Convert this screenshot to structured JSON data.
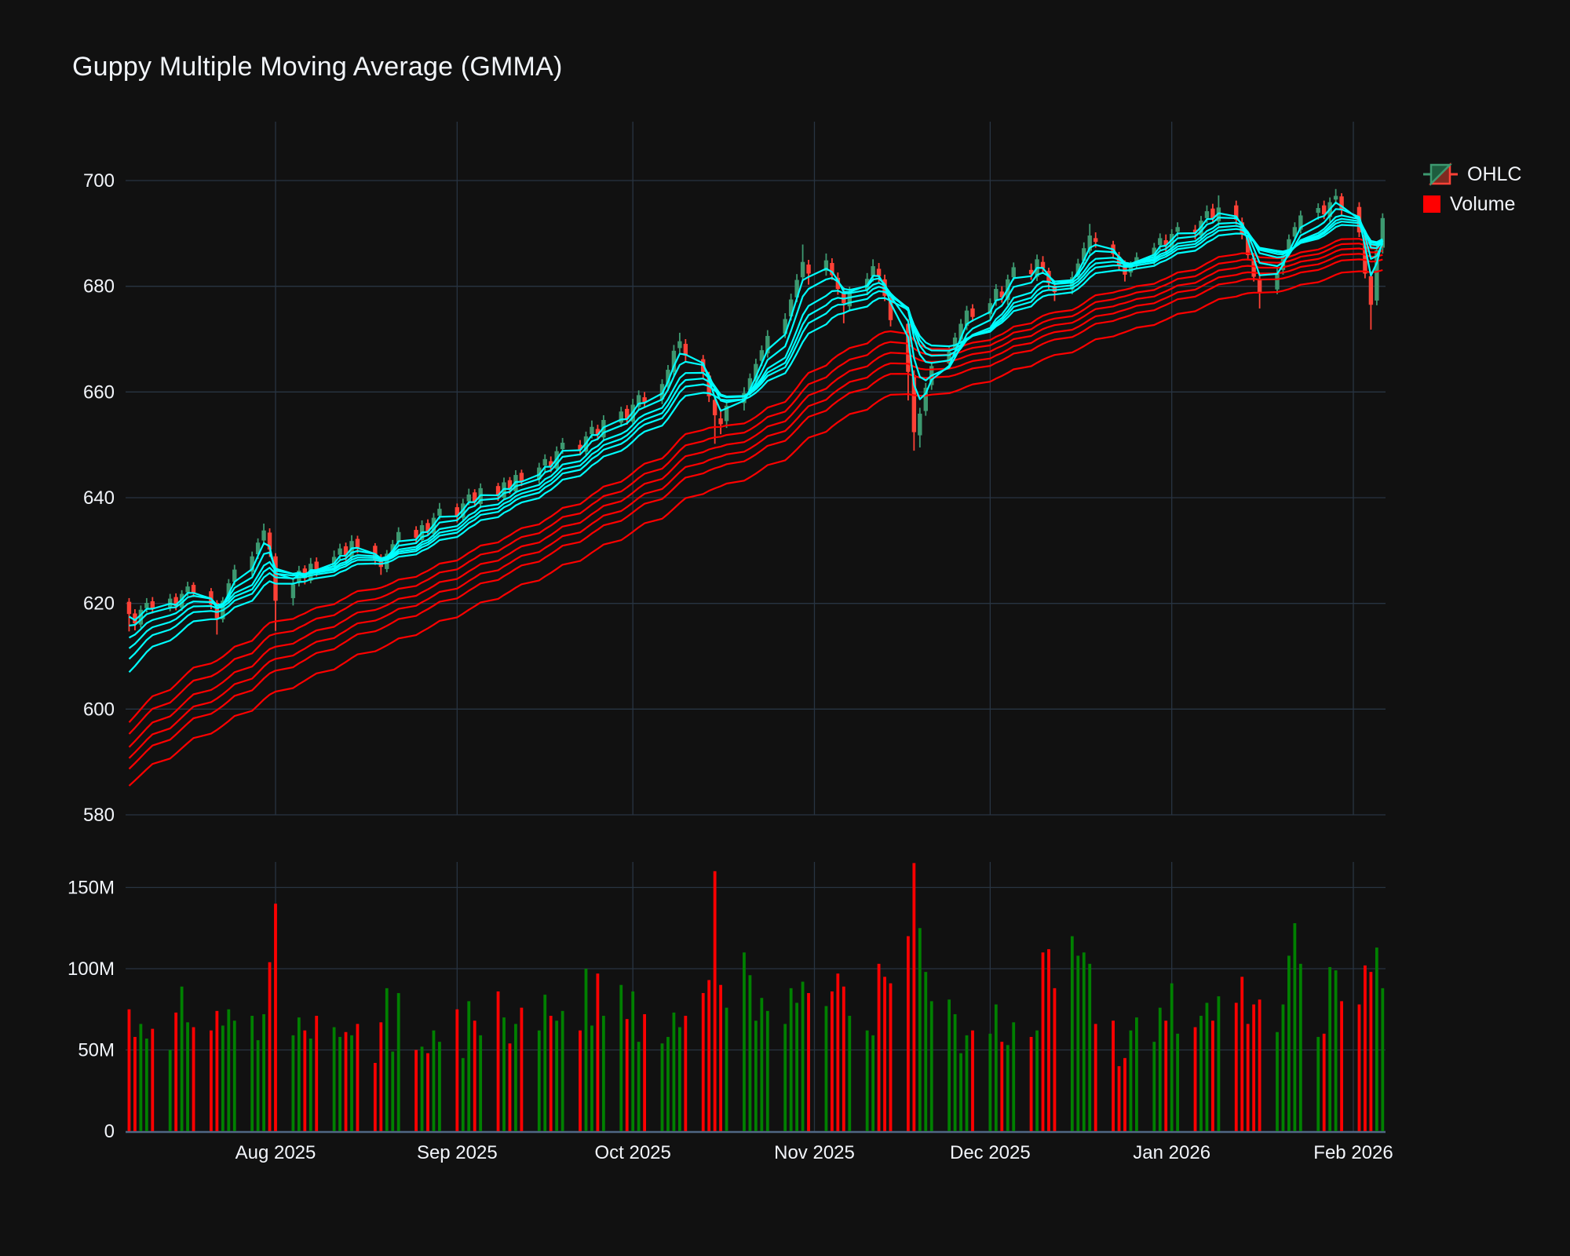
{
  "title": "Guppy Multiple Moving Average (GMMA)",
  "legend": {
    "ohlc_label": "OHLC",
    "volume_label": "Volume"
  },
  "colors": {
    "background": "#111111",
    "grid": "#283442",
    "axis_line": "#506784",
    "text": "#f2f5fa",
    "candle_up": "#3D9970",
    "candle_down": "#FF4136",
    "volume_up": "#008000",
    "volume_down": "#FF0000",
    "gmma_short": "#00FFFF",
    "gmma_long": "#FF0000"
  },
  "chart_data": {
    "type": "candlestick",
    "title": "Guppy Multiple Moving Average (GMMA)",
    "start_date": "2025-07-07",
    "frequency": "business_days",
    "open": [
      620.3,
      618.1,
      616.0,
      619.1,
      620.4,
      619.3,
      621.2,
      619.2,
      622.1,
      623.5,
      622.3,
      620.1,
      617.0,
      620.9,
      624.1,
      626.0,
      629.3,
      631.9,
      633.4,
      628.9,
      621.0,
      624.0,
      626.6,
      624.3,
      627.9,
      627.0,
      629.2,
      630.8,
      628.7,
      632.2,
      630.9,
      628.6,
      626.5,
      629.8,
      631.6,
      633.9,
      632.0,
      635.2,
      633.2,
      636.6,
      638.2,
      636.2,
      639.3,
      641.0,
      638.8,
      642.2,
      640.0,
      643.3,
      641.2,
      644.7,
      643.5,
      646.1,
      646.9,
      645.5,
      649.2,
      650.0,
      648.7,
      652.0,
      653.0,
      651.4,
      654.2,
      656.8,
      654.4,
      657.2,
      659.0,
      658.6,
      661.0,
      663.8,
      668.3,
      669.1,
      666.2,
      663.1,
      658.5,
      655.0,
      654.5,
      657.9,
      660.3,
      662.0,
      665.9,
      667.3,
      671.0,
      674.3,
      677.9,
      681.7,
      684.1,
      682.9,
      684.4,
      681.6,
      678.9,
      676.2,
      679.4,
      681.9,
      683.3,
      681.3,
      677.6,
      672.9,
      663.2,
      651.8,
      656.4,
      661.3,
      665.4,
      668.1,
      669.9,
      672.5,
      675.8,
      674.7,
      677.2,
      679.0,
      677.4,
      681.7,
      683.1,
      681.8,
      684.6,
      682.9,
      680.1,
      679.4,
      682.1,
      684.8,
      686.7,
      689.1,
      687.9,
      685.6,
      684.3,
      682.6,
      684.2,
      685.0,
      687.8,
      688.7,
      687.3,
      690.3,
      690.7,
      689.6,
      692.9,
      694.7,
      692.3,
      695.3,
      692.1,
      689.3,
      685.4,
      681.3,
      679.4,
      683.1,
      686.3,
      689.4,
      690.7,
      693.9,
      695.3,
      693.1,
      696.4,
      697.0,
      695.0,
      689.7,
      681.9,
      677.3,
      687.3
    ],
    "high": [
      621.0,
      618.9,
      619.6,
      621.0,
      621.2,
      621.8,
      621.9,
      622.5,
      624.1,
      624.0,
      622.9,
      620.6,
      621.2,
      624.6,
      627.3,
      629.8,
      632.3,
      635.1,
      634.2,
      629.5,
      624.8,
      627.1,
      627.2,
      628.6,
      628.7,
      630.0,
      631.3,
      631.5,
      632.9,
      632.8,
      631.4,
      629.3,
      630.1,
      632.0,
      634.4,
      634.6,
      635.7,
      635.9,
      637.1,
      639.0,
      638.9,
      639.8,
      641.7,
      641.6,
      642.7,
      642.8,
      643.8,
      643.9,
      645.2,
      645.3,
      646.6,
      648.2,
      647.8,
      649.7,
      651.3,
      650.9,
      652.5,
      654.6,
      653.8,
      655.6,
      657.2,
      657.5,
      658.7,
      660.3,
      660.0,
      662.4,
      665.1,
      668.9,
      671.2,
      670.0,
      667.0,
      663.8,
      659.4,
      656.8,
      658.3,
      660.9,
      663.5,
      666.3,
      668.8,
      671.7,
      674.9,
      678.6,
      682.3,
      687.9,
      685.0,
      686.2,
      685.3,
      682.6,
      679.8,
      679.9,
      682.5,
      685.1,
      684.4,
      682.2,
      678.5,
      673.8,
      664.1,
      657.0,
      661.7,
      665.8,
      668.5,
      671.2,
      673.8,
      676.3,
      676.6,
      677.7,
      680.4,
      680.0,
      682.2,
      684.5,
      684.3,
      686.0,
      685.7,
      683.5,
      681.0,
      682.8,
      685.2,
      688.3,
      691.8,
      690.2,
      688.6,
      686.5,
      684.9,
      684.7,
      686.4,
      688.2,
      690.0,
      689.8,
      690.8,
      692.1,
      691.6,
      693.3,
      695.3,
      695.6,
      697.2,
      696.2,
      693.0,
      690.1,
      686.3,
      682.2,
      683.5,
      686.7,
      689.8,
      692.1,
      694.3,
      695.7,
      696.2,
      696.8,
      698.4,
      697.6,
      695.9,
      690.5,
      682.8,
      688.0,
      693.8
    ],
    "low": [
      614.7,
      614.9,
      615.4,
      618.3,
      618.1,
      618.5,
      618.7,
      618.6,
      621.4,
      621.2,
      618.9,
      614.1,
      616.4,
      620.2,
      623.4,
      625.2,
      628.4,
      631.0,
      628.8,
      614.8,
      619.6,
      623.2,
      623.6,
      623.8,
      625.1,
      626.1,
      628.3,
      628.0,
      628.1,
      629.5,
      627.3,
      625.4,
      625.9,
      629.0,
      630.8,
      631.5,
      631.4,
      632.8,
      632.6,
      635.9,
      635.3,
      635.5,
      638.6,
      638.3,
      638.0,
      639.4,
      639.6,
      640.7,
      640.8,
      642.2,
      642.7,
      644.9,
      644.8,
      645.0,
      648.3,
      648.0,
      648.1,
      651.2,
      650.9,
      650.8,
      653.4,
      653.8,
      653.9,
      656.6,
      657.0,
      657.7,
      660.2,
      663.0,
      667.4,
      665.8,
      662.4,
      658.1,
      650.2,
      652.0,
      653.2,
      656.5,
      659.3,
      661.2,
      664.9,
      666.5,
      670.2,
      673.5,
      677.0,
      681.0,
      680.3,
      682.0,
      681.2,
      678.4,
      673.0,
      675.3,
      678.3,
      680.9,
      680.8,
      677.2,
      672.4,
      658.4,
      648.9,
      649.5,
      655.5,
      660.4,
      664.5,
      667.2,
      669.0,
      671.7,
      673.3,
      673.8,
      676.3,
      676.9,
      676.5,
      681.1,
      681.2,
      681.0,
      682.5,
      679.5,
      677.2,
      678.5,
      681.3,
      684.0,
      686.1,
      687.3,
      685.2,
      683.0,
      680.9,
      681.8,
      683.4,
      684.1,
      686.9,
      686.4,
      686.5,
      689.4,
      688.9,
      688.7,
      692.0,
      691.9,
      691.4,
      691.7,
      688.9,
      684.9,
      680.9,
      675.8,
      678.5,
      682.2,
      685.4,
      688.5,
      690.0,
      692.6,
      692.7,
      692.2,
      695.5,
      693.5,
      689.3,
      681.5,
      671.8,
      676.4,
      686.2
    ],
    "close": [
      618.0,
      616.2,
      618.8,
      620.1,
      619.0,
      620.9,
      619.5,
      621.8,
      623.2,
      622.0,
      619.8,
      617.2,
      620.5,
      623.8,
      626.4,
      628.9,
      631.5,
      633.8,
      630.2,
      620.5,
      623.6,
      626.2,
      624.8,
      627.5,
      626.3,
      628.8,
      630.4,
      629.1,
      631.8,
      630.6,
      628.2,
      626.9,
      629.4,
      631.2,
      633.5,
      632.4,
      634.8,
      633.6,
      636.2,
      637.9,
      636.6,
      638.9,
      640.6,
      639.2,
      641.8,
      640.4,
      642.9,
      641.6,
      644.3,
      643.1,
      645.7,
      647.3,
      645.9,
      648.8,
      650.4,
      649.1,
      651.6,
      653.4,
      651.9,
      654.7,
      656.3,
      654.9,
      657.6,
      659.4,
      658.1,
      661.5,
      664.2,
      667.8,
      669.6,
      666.9,
      663.8,
      659.2,
      655.6,
      653.9,
      657.4,
      659.8,
      662.6,
      665.3,
      667.9,
      670.6,
      673.8,
      677.5,
      681.2,
      684.6,
      682.4,
      684.9,
      682.1,
      679.5,
      676.8,
      678.9,
      681.4,
      683.8,
      681.9,
      678.2,
      673.6,
      663.8,
      652.4,
      655.9,
      660.8,
      664.9,
      667.6,
      670.3,
      672.9,
      675.4,
      674.2,
      676.8,
      679.5,
      677.9,
      681.3,
      683.6,
      682.3,
      685.1,
      683.4,
      680.6,
      678.9,
      681.7,
      684.3,
      687.2,
      689.6,
      688.4,
      686.1,
      683.9,
      682.2,
      683.8,
      685.5,
      687.3,
      689.1,
      687.8,
      689.9,
      691.2,
      690.1,
      692.4,
      694.2,
      692.8,
      694.9,
      692.6,
      689.8,
      685.9,
      681.8,
      678.9,
      682.6,
      685.8,
      688.9,
      691.2,
      693.4,
      694.8,
      693.6,
      695.9,
      697.1,
      694.4,
      690.2,
      682.4,
      676.5,
      686.8,
      692.9
    ],
    "volume_millions": [
      75,
      58,
      66,
      57,
      63,
      50,
      73,
      89,
      67,
      64,
      62,
      74,
      65,
      75,
      68,
      71,
      56,
      72,
      104,
      140,
      59,
      70,
      62,
      57,
      71,
      64,
      58,
      61,
      59,
      66,
      42,
      67,
      88,
      49,
      85,
      50,
      52,
      48,
      62,
      55,
      75,
      45,
      80,
      68,
      59,
      86,
      70,
      54,
      66,
      76,
      62,
      84,
      71,
      68,
      74,
      62,
      100,
      65,
      97,
      71,
      90,
      69,
      86,
      55,
      72,
      54,
      58,
      73,
      64,
      71,
      85,
      93,
      160,
      90,
      76,
      110,
      96,
      68,
      82,
      74,
      66,
      88,
      79,
      92,
      85,
      77,
      86,
      97,
      89,
      71,
      62,
      59,
      103,
      95,
      91,
      120,
      165,
      125,
      98,
      80,
      81,
      72,
      48,
      59,
      62,
      60,
      78,
      55,
      53,
      67,
      58,
      62,
      110,
      112,
      88,
      120,
      108,
      110,
      103,
      66,
      68,
      40,
      45,
      62,
      70,
      55,
      76,
      68,
      91,
      60,
      64,
      71,
      79,
      68,
      83,
      79,
      95,
      66,
      78,
      81,
      61,
      78,
      108,
      128,
      103,
      58,
      60,
      101,
      99,
      80,
      78,
      102,
      98,
      113,
      88
    ],
    "gmma": {
      "short_periods": [
        3,
        5,
        8,
        10,
        12,
        15
      ],
      "short_seed_values": [
        617.5,
        615.8,
        613.5,
        611.5,
        609.5,
        607.0
      ],
      "long_periods": [
        30,
        35,
        40,
        45,
        50,
        60
      ],
      "long_seed_values": [
        597.5,
        595.3,
        592.8,
        590.7,
        588.7,
        585.5
      ]
    },
    "price_axis": {
      "ticks": [
        580,
        600,
        620,
        640,
        660,
        680,
        700
      ]
    },
    "volume_axis": {
      "ticks": [
        {
          "value": 0,
          "label": "0"
        },
        {
          "value": 50,
          "label": "50M"
        },
        {
          "value": 100,
          "label": "100M"
        },
        {
          "value": 150,
          "label": "150M"
        }
      ]
    },
    "x_axis": {
      "ticks": [
        {
          "date": "2025-08-01",
          "label": "Aug 2025"
        },
        {
          "date": "2025-09-01",
          "label": "Sep 2025"
        },
        {
          "date": "2025-10-01",
          "label": "Oct 2025"
        },
        {
          "date": "2025-11-01",
          "label": "Nov 2025"
        },
        {
          "date": "2025-12-01",
          "label": "Dec 2025"
        },
        {
          "date": "2026-01-01",
          "label": "Jan 2026"
        },
        {
          "date": "2026-02-01",
          "label": "Feb 2026"
        }
      ]
    }
  }
}
